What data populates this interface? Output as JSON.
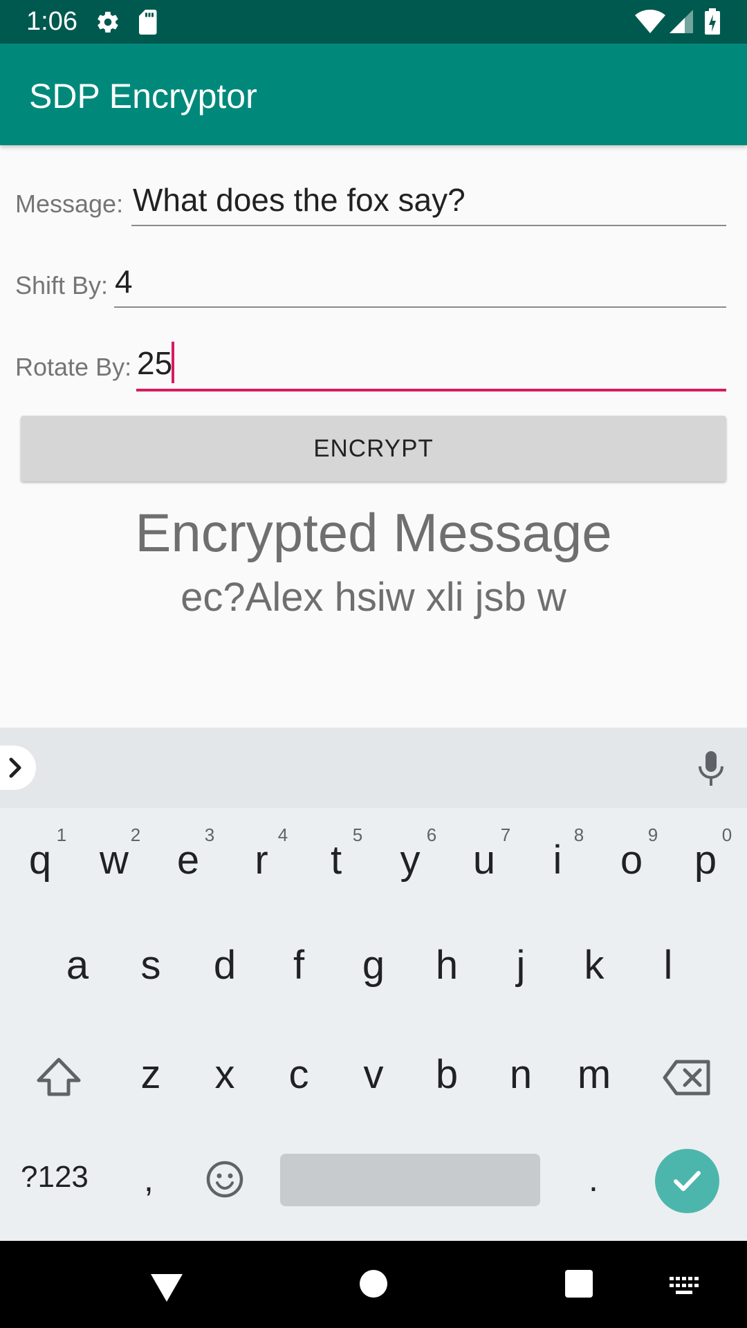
{
  "status_bar": {
    "time": "1:06",
    "icons": [
      "gear-icon",
      "sd-card-icon",
      "wifi-icon",
      "signal-icon",
      "battery-charging-icon"
    ]
  },
  "app_bar": {
    "title": "SDP Encryptor",
    "color": "#00897b"
  },
  "form": {
    "message": {
      "label": "Message:",
      "value": "What does the fox say?"
    },
    "shift": {
      "label": "Shift By:",
      "value": "4"
    },
    "rotate": {
      "label": "Rotate By:",
      "value": "25",
      "focused": true
    }
  },
  "encrypt_button": {
    "label": "ENCRYPT"
  },
  "result": {
    "title": "Encrypted Message",
    "value": "ec?Alex hsiw xli jsb w"
  },
  "keyboard": {
    "row1": [
      {
        "key": "q",
        "hint": "1"
      },
      {
        "key": "w",
        "hint": "2"
      },
      {
        "key": "e",
        "hint": "3"
      },
      {
        "key": "r",
        "hint": "4"
      },
      {
        "key": "t",
        "hint": "5"
      },
      {
        "key": "y",
        "hint": "6"
      },
      {
        "key": "u",
        "hint": "7"
      },
      {
        "key": "i",
        "hint": "8"
      },
      {
        "key": "o",
        "hint": "9"
      },
      {
        "key": "p",
        "hint": "0"
      }
    ],
    "row2": [
      "a",
      "s",
      "d",
      "f",
      "g",
      "h",
      "j",
      "k",
      "l"
    ],
    "row3": [
      "z",
      "x",
      "c",
      "v",
      "b",
      "n",
      "m"
    ],
    "symbols_label": "?123",
    "comma": ",",
    "period": ".",
    "accent": "#4db6ac"
  },
  "nav_bar": {
    "icons": [
      "back-icon",
      "home-icon",
      "recents-icon",
      "keyboard-switch-icon"
    ]
  }
}
